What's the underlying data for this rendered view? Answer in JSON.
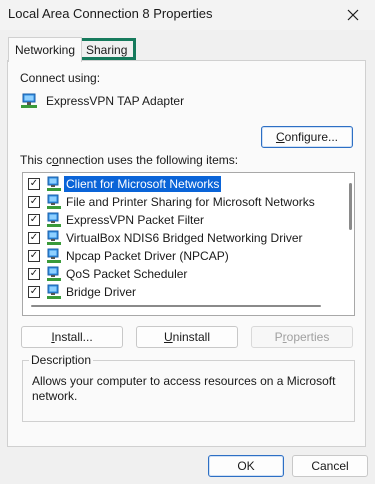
{
  "window": {
    "title": "Local Area Connection 8 Properties"
  },
  "tabs": [
    {
      "label": "Networking",
      "active": true
    },
    {
      "label": "Sharing",
      "active": false
    }
  ],
  "connect_using": {
    "label": "Connect using:",
    "adapter": "ExpressVPN TAP Adapter",
    "adapter_icon": "network-adapter-icon"
  },
  "buttons": {
    "configure": {
      "label": "Configure...",
      "accel": "C",
      "rest": "onfigure..."
    },
    "install": {
      "label": "Install...",
      "accel": "I",
      "rest": "nstall..."
    },
    "uninstall": {
      "label": "Uninstall",
      "accel": "U",
      "rest": "ninstall"
    },
    "properties": {
      "label": "Properties",
      "pre": "P",
      "accel": "r",
      "rest": "operties",
      "enabled": false
    },
    "ok": {
      "label": "OK"
    },
    "cancel": {
      "label": "Cancel"
    }
  },
  "items_label": {
    "label": "This connection uses the following items:",
    "pre": "This c",
    "accel": "o",
    "rest": "nnection uses the following items:"
  },
  "items": [
    {
      "label": "Client for Microsoft Networks",
      "checked": true,
      "selected": true
    },
    {
      "label": "File and Printer Sharing for Microsoft Networks",
      "checked": true,
      "selected": false
    },
    {
      "label": "ExpressVPN Packet Filter",
      "checked": true,
      "selected": false
    },
    {
      "label": "VirtualBox NDIS6 Bridged Networking Driver",
      "checked": true,
      "selected": false
    },
    {
      "label": "Npcap Packet Driver (NPCAP)",
      "checked": true,
      "selected": false
    },
    {
      "label": "QoS Packet Scheduler",
      "checked": true,
      "selected": false
    },
    {
      "label": "Bridge Driver",
      "checked": true,
      "selected": false
    }
  ],
  "description": {
    "legend": "Description",
    "text": "Allows your computer to access resources on a Microsoft network."
  },
  "colors": {
    "selection": "#0a64d8",
    "highlight_border": "#167a5c",
    "accent_border": "#2d6fc4"
  }
}
